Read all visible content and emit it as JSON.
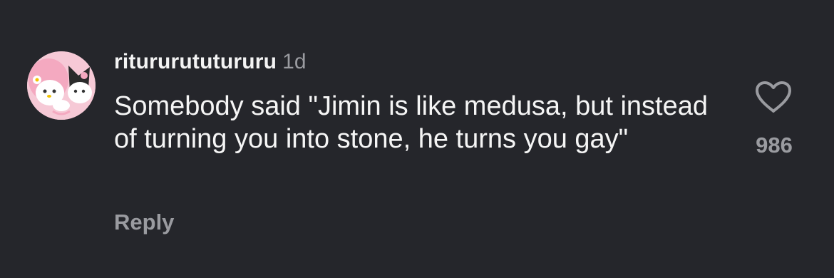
{
  "comment": {
    "username": "ritururututururu",
    "time": "1d",
    "text": "Somebody said \"Jimin is like medusa, but instead of turning you into stone, he turns you gay\"",
    "reply_label": "Reply",
    "like_icon": "heart-outline-icon",
    "like_count": "986"
  },
  "colors": {
    "background": "#25262b",
    "text_primary": "#f5f5f5",
    "text_secondary": "#9a9ba0"
  }
}
